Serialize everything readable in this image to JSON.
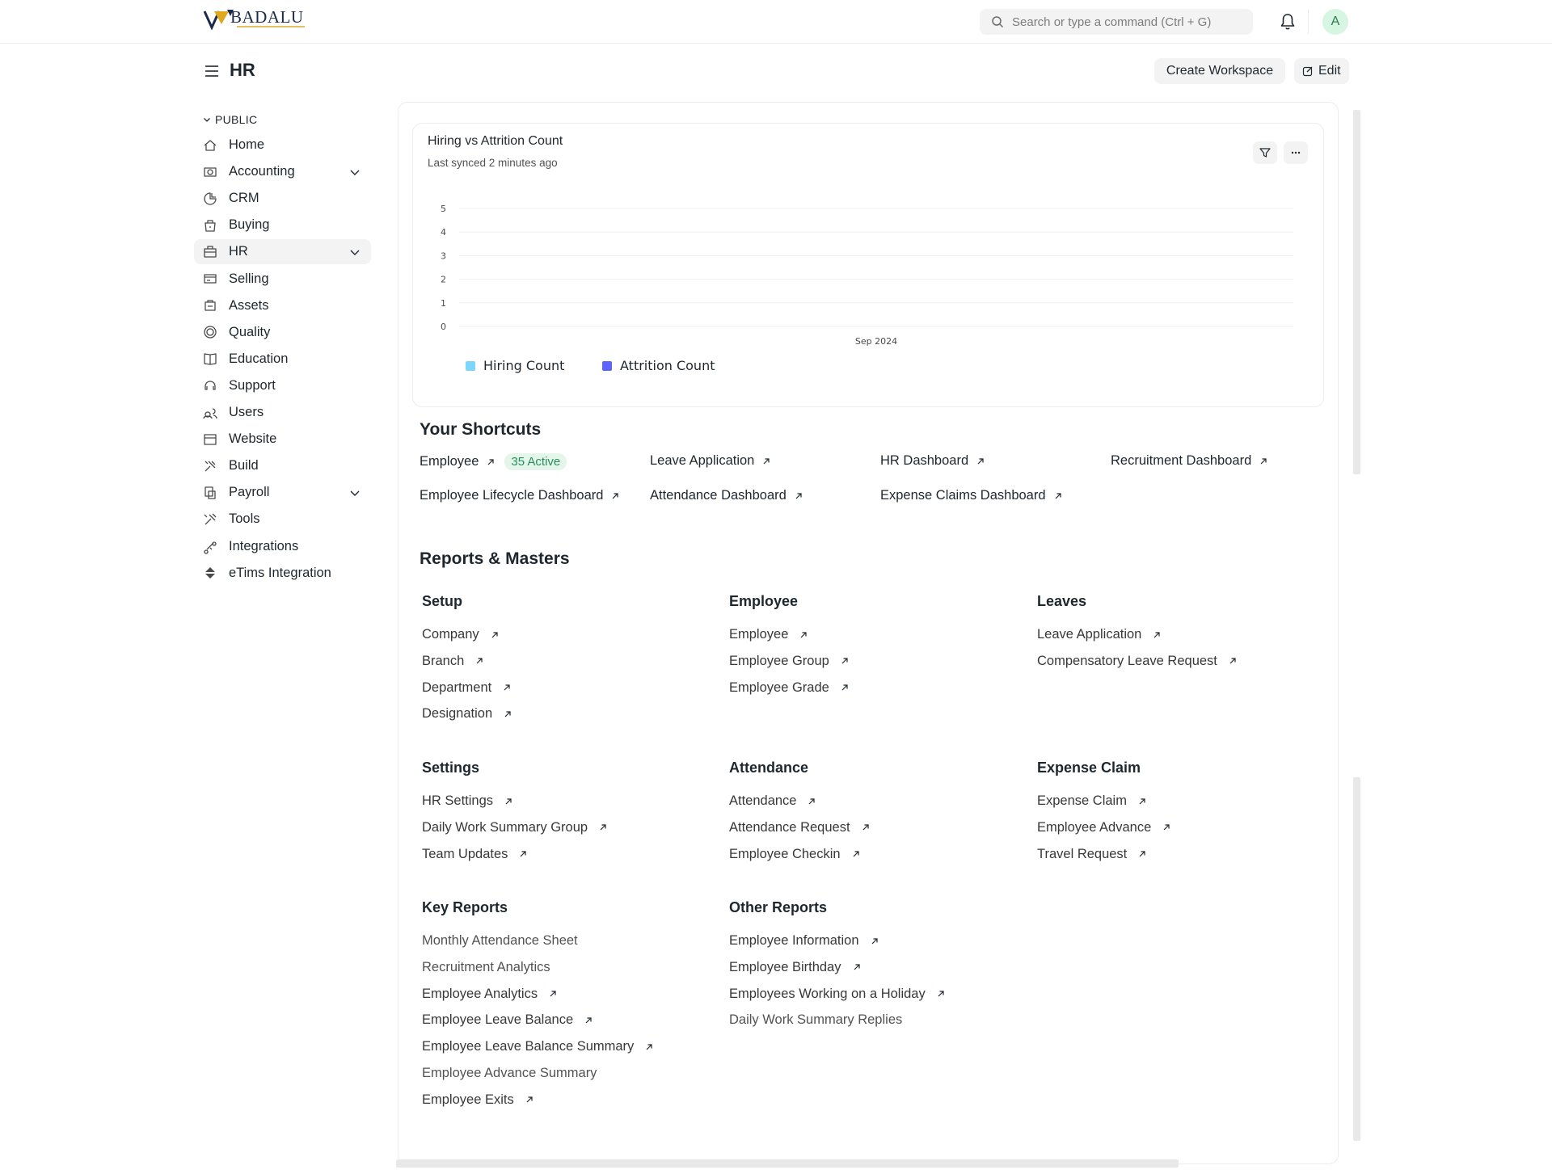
{
  "navbar": {
    "brand": "BADALU",
    "search_placeholder": "Search or type a command (Ctrl + G)",
    "avatar_initial": "A"
  },
  "header": {
    "title": "HR",
    "create_workspace": "Create Workspace",
    "edit": "Edit"
  },
  "sidebar": {
    "section": "PUBLIC",
    "items": [
      {
        "label": "Home",
        "icon": "home-icon"
      },
      {
        "label": "Accounting",
        "icon": "accounting-icon"
      },
      {
        "label": "CRM",
        "icon": "crm-icon"
      },
      {
        "label": "Buying",
        "icon": "buying-icon"
      },
      {
        "label": "HR",
        "icon": "hr-icon"
      },
      {
        "label": "Selling",
        "icon": "selling-icon"
      },
      {
        "label": "Assets",
        "icon": "assets-icon"
      },
      {
        "label": "Quality",
        "icon": "quality-icon"
      },
      {
        "label": "Education",
        "icon": "education-icon"
      },
      {
        "label": "Support",
        "icon": "support-icon"
      },
      {
        "label": "Users",
        "icon": "users-icon"
      },
      {
        "label": "Website",
        "icon": "website-icon"
      },
      {
        "label": "Build",
        "icon": "build-icon"
      },
      {
        "label": "Payroll",
        "icon": "payroll-icon"
      },
      {
        "label": "Tools",
        "icon": "tools-icon"
      },
      {
        "label": "Integrations",
        "icon": "integrations-icon"
      },
      {
        "label": "eTims Integration",
        "icon": "etims-icon"
      }
    ]
  },
  "chart": {
    "title": "Hiring vs Attrition Count",
    "subtitle": "Last synced 2 minutes ago"
  },
  "chart_data": {
    "type": "bar",
    "title": "Hiring vs Attrition Count",
    "categories": [
      "Sep 2024"
    ],
    "series": [
      {
        "name": "Hiring Count",
        "values": [
          0
        ],
        "color": "#7cd6fd"
      },
      {
        "name": "Attrition Count",
        "values": [
          0
        ],
        "color": "#5e64ff"
      }
    ],
    "y_ticks": [
      "0",
      "1",
      "2",
      "3",
      "4",
      "5"
    ],
    "ylim": [
      0,
      5
    ],
    "grid": true,
    "legend": "bottom-left"
  },
  "shortcuts": {
    "title": "Your Shortcuts",
    "items": [
      {
        "label": "Employee",
        "badge": "35 Active"
      },
      {
        "label": "Leave Application"
      },
      {
        "label": "HR Dashboard"
      },
      {
        "label": "Recruitment Dashboard"
      },
      {
        "label": "Employee Lifecycle Dashboard"
      },
      {
        "label": "Attendance Dashboard"
      },
      {
        "label": "Expense Claims Dashboard"
      }
    ]
  },
  "reports": {
    "title": "Reports & Masters",
    "cards": [
      {
        "title": "Setup",
        "links": [
          "Company",
          "Branch",
          "Department",
          "Designation"
        ]
      },
      {
        "title": "Employee",
        "links": [
          "Employee",
          "Employee Group",
          "Employee Grade"
        ]
      },
      {
        "title": "Leaves",
        "links": [
          "Leave Application",
          "Compensatory Leave Request"
        ]
      },
      {
        "title": "Settings",
        "links": [
          "HR Settings",
          "Daily Work Summary Group",
          "Team Updates"
        ]
      },
      {
        "title": "Attendance",
        "links": [
          "Attendance",
          "Attendance Request",
          "Employee Checkin"
        ]
      },
      {
        "title": "Expense Claim",
        "links": [
          "Expense Claim",
          "Employee Advance",
          "Travel Request"
        ]
      },
      {
        "title": "Key Reports",
        "links": [
          "Monthly Attendance Sheet",
          "Recruitment Analytics",
          "Employee Analytics",
          "Employee Leave Balance",
          "Employee Leave Balance Summary",
          "Employee Advance Summary",
          "Employee Exits"
        ]
      },
      {
        "title": "Other Reports",
        "links": [
          "Employee Information",
          "Employee Birthday",
          "Employees Working on a Holiday",
          "Daily Work Summary Replies"
        ]
      }
    ]
  }
}
